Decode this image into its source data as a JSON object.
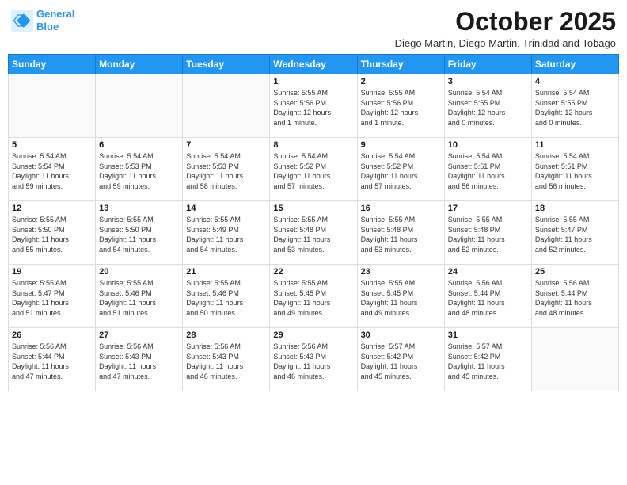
{
  "header": {
    "logo_line1": "General",
    "logo_line2": "Blue",
    "month": "October 2025",
    "location": "Diego Martin, Diego Martin, Trinidad and Tobago"
  },
  "days_of_week": [
    "Sunday",
    "Monday",
    "Tuesday",
    "Wednesday",
    "Thursday",
    "Friday",
    "Saturday"
  ],
  "weeks": [
    [
      {
        "day": "",
        "info": ""
      },
      {
        "day": "",
        "info": ""
      },
      {
        "day": "",
        "info": ""
      },
      {
        "day": "1",
        "info": "Sunrise: 5:55 AM\nSunset: 5:56 PM\nDaylight: 12 hours\nand 1 minute."
      },
      {
        "day": "2",
        "info": "Sunrise: 5:55 AM\nSunset: 5:56 PM\nDaylight: 12 hours\nand 1 minute."
      },
      {
        "day": "3",
        "info": "Sunrise: 5:54 AM\nSunset: 5:55 PM\nDaylight: 12 hours\nand 0 minutes."
      },
      {
        "day": "4",
        "info": "Sunrise: 5:54 AM\nSunset: 5:55 PM\nDaylight: 12 hours\nand 0 minutes."
      }
    ],
    [
      {
        "day": "5",
        "info": "Sunrise: 5:54 AM\nSunset: 5:54 PM\nDaylight: 11 hours\nand 59 minutes."
      },
      {
        "day": "6",
        "info": "Sunrise: 5:54 AM\nSunset: 5:53 PM\nDaylight: 11 hours\nand 59 minutes."
      },
      {
        "day": "7",
        "info": "Sunrise: 5:54 AM\nSunset: 5:53 PM\nDaylight: 11 hours\nand 58 minutes."
      },
      {
        "day": "8",
        "info": "Sunrise: 5:54 AM\nSunset: 5:52 PM\nDaylight: 11 hours\nand 57 minutes."
      },
      {
        "day": "9",
        "info": "Sunrise: 5:54 AM\nSunset: 5:52 PM\nDaylight: 11 hours\nand 57 minutes."
      },
      {
        "day": "10",
        "info": "Sunrise: 5:54 AM\nSunset: 5:51 PM\nDaylight: 11 hours\nand 56 minutes."
      },
      {
        "day": "11",
        "info": "Sunrise: 5:54 AM\nSunset: 5:51 PM\nDaylight: 11 hours\nand 56 minutes."
      }
    ],
    [
      {
        "day": "12",
        "info": "Sunrise: 5:55 AM\nSunset: 5:50 PM\nDaylight: 11 hours\nand 55 minutes."
      },
      {
        "day": "13",
        "info": "Sunrise: 5:55 AM\nSunset: 5:50 PM\nDaylight: 11 hours\nand 54 minutes."
      },
      {
        "day": "14",
        "info": "Sunrise: 5:55 AM\nSunset: 5:49 PM\nDaylight: 11 hours\nand 54 minutes."
      },
      {
        "day": "15",
        "info": "Sunrise: 5:55 AM\nSunset: 5:48 PM\nDaylight: 11 hours\nand 53 minutes."
      },
      {
        "day": "16",
        "info": "Sunrise: 5:55 AM\nSunset: 5:48 PM\nDaylight: 11 hours\nand 53 minutes."
      },
      {
        "day": "17",
        "info": "Sunrise: 5:55 AM\nSunset: 5:48 PM\nDaylight: 11 hours\nand 52 minutes."
      },
      {
        "day": "18",
        "info": "Sunrise: 5:55 AM\nSunset: 5:47 PM\nDaylight: 11 hours\nand 52 minutes."
      }
    ],
    [
      {
        "day": "19",
        "info": "Sunrise: 5:55 AM\nSunset: 5:47 PM\nDaylight: 11 hours\nand 51 minutes."
      },
      {
        "day": "20",
        "info": "Sunrise: 5:55 AM\nSunset: 5:46 PM\nDaylight: 11 hours\nand 51 minutes."
      },
      {
        "day": "21",
        "info": "Sunrise: 5:55 AM\nSunset: 5:46 PM\nDaylight: 11 hours\nand 50 minutes."
      },
      {
        "day": "22",
        "info": "Sunrise: 5:55 AM\nSunset: 5:45 PM\nDaylight: 11 hours\nand 49 minutes."
      },
      {
        "day": "23",
        "info": "Sunrise: 5:55 AM\nSunset: 5:45 PM\nDaylight: 11 hours\nand 49 minutes."
      },
      {
        "day": "24",
        "info": "Sunrise: 5:56 AM\nSunset: 5:44 PM\nDaylight: 11 hours\nand 48 minutes."
      },
      {
        "day": "25",
        "info": "Sunrise: 5:56 AM\nSunset: 5:44 PM\nDaylight: 11 hours\nand 48 minutes."
      }
    ],
    [
      {
        "day": "26",
        "info": "Sunrise: 5:56 AM\nSunset: 5:44 PM\nDaylight: 11 hours\nand 47 minutes."
      },
      {
        "day": "27",
        "info": "Sunrise: 5:56 AM\nSunset: 5:43 PM\nDaylight: 11 hours\nand 47 minutes."
      },
      {
        "day": "28",
        "info": "Sunrise: 5:56 AM\nSunset: 5:43 PM\nDaylight: 11 hours\nand 46 minutes."
      },
      {
        "day": "29",
        "info": "Sunrise: 5:56 AM\nSunset: 5:43 PM\nDaylight: 11 hours\nand 46 minutes."
      },
      {
        "day": "30",
        "info": "Sunrise: 5:57 AM\nSunset: 5:42 PM\nDaylight: 11 hours\nand 45 minutes."
      },
      {
        "day": "31",
        "info": "Sunrise: 5:57 AM\nSunset: 5:42 PM\nDaylight: 11 hours\nand 45 minutes."
      },
      {
        "day": "",
        "info": ""
      }
    ]
  ]
}
